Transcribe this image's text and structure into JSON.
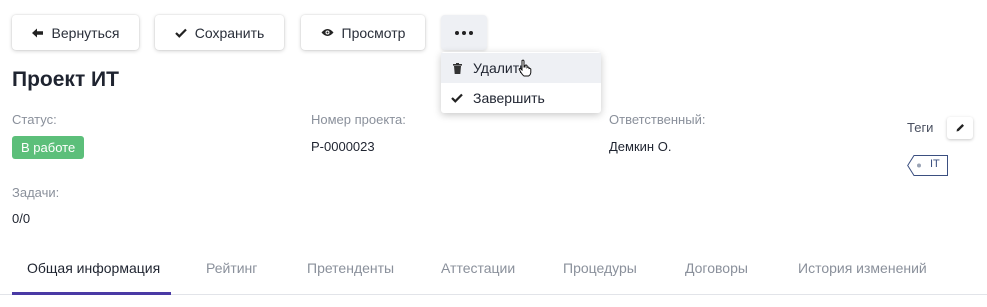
{
  "toolbar": {
    "back_label": "Вернуться",
    "save_label": "Сохранить",
    "view_label": "Просмотр"
  },
  "dropdown": {
    "items": [
      {
        "label": "Удалить",
        "icon": "trash-icon"
      },
      {
        "label": "Завершить",
        "icon": "check-icon"
      }
    ]
  },
  "project": {
    "title": "Проект ИТ",
    "status_label": "Статус:",
    "status_value": "В работе",
    "number_label": "Номер проекта:",
    "number_value": "Р-0000023",
    "responsible_label": "Ответственный:",
    "responsible_value": "Демкин О.",
    "tasks_label": "Задачи:",
    "tasks_value": "0/0"
  },
  "tags": {
    "label": "Теги",
    "items": [
      "IT"
    ]
  },
  "tabs": [
    {
      "label": "Общая информация",
      "active": true
    },
    {
      "label": "Рейтинг"
    },
    {
      "label": "Претенденты"
    },
    {
      "label": "Аттестации"
    },
    {
      "label": "Процедуры"
    },
    {
      "label": "Договоры"
    },
    {
      "label": "История изменений"
    }
  ],
  "colors": {
    "status_green": "#5cbf7a",
    "accent_purple": "#4a3aa5",
    "tag_blue": "#3b4f80"
  }
}
